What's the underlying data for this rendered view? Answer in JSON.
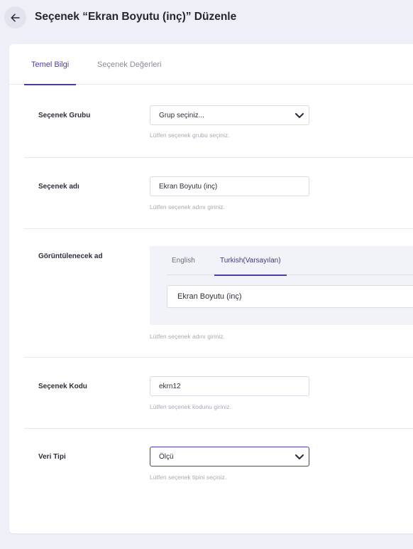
{
  "header": {
    "title": "Seçenek “Ekran Boyutu (inç)” Düzenle",
    "back_icon": "arrow-left-icon"
  },
  "tabs": [
    {
      "label": "Temel Bilgi",
      "active": true
    },
    {
      "label": "Seçenek Değerleri",
      "active": false
    }
  ],
  "form": {
    "option_group": {
      "label": "Seçenek Grubu",
      "value": "Grup seçiniz...",
      "hint": "Lütfen seçenek grubu seçiniz."
    },
    "option_name": {
      "label": "Seçenek adı",
      "value": "Ekran Boyutu (inç)",
      "hint": "Lütfen seçenek adını giriniz."
    },
    "display_name": {
      "label": "Görüntülenecek ad",
      "languages": [
        {
          "label": "English",
          "active": false
        },
        {
          "label": "Turkish(Varsayılan)",
          "active": true
        }
      ],
      "value": "Ekran Boyutu (inç)",
      "hint": "Lütfen seçenek adını giriniz."
    },
    "option_code": {
      "label": "Seçenek Kodu",
      "value": "ekrn12",
      "hint": "Lütfen seçenek kodunu giriniz."
    },
    "data_type": {
      "label": "Veri Tipi",
      "value": "Ölçü",
      "hint": "Lütfen seçenek tipini seçiniz."
    }
  },
  "colors": {
    "accent": "#4b3ca7",
    "background": "#eef0f7",
    "hint": "#a9aab6"
  }
}
